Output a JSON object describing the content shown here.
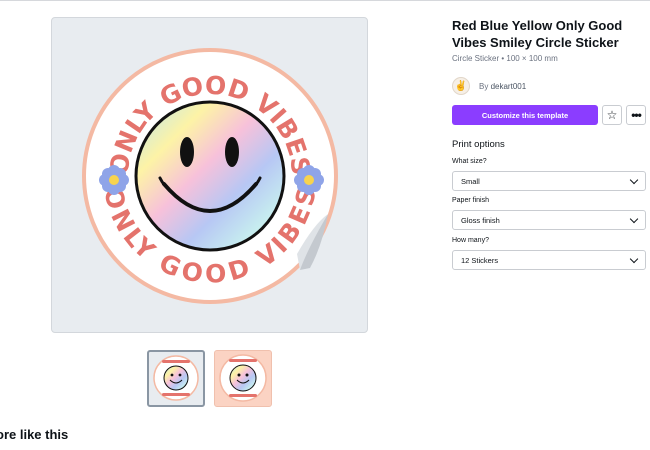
{
  "product": {
    "title": "Red Blue Yellow Only Good Vibes Smiley Circle Sticker",
    "subtitle": "Circle Sticker • 100 × 100 mm",
    "author_prefix": "By",
    "author_name": "dekart001"
  },
  "actions": {
    "customize_label": "Customize this template",
    "favorite_icon": "star-icon",
    "more_icon": "more-options-icon"
  },
  "print_options": {
    "heading": "Print options",
    "size": {
      "label": "What size?",
      "value": "Small"
    },
    "paper": {
      "label": "Paper finish",
      "value": "Gloss finish"
    },
    "quantity": {
      "label": "How many?",
      "value": "12 Stickers"
    }
  },
  "sticker": {
    "text_top": "ONLY GOOD VIBES",
    "text_bottom": "ONLY GOOD VIBES"
  },
  "more_like_this": "ore like this",
  "colors": {
    "accent": "#8b3dff",
    "sticker_text": "#e4736c",
    "sticker_ring": "#f4b9a3",
    "flower": "#8fa4e8"
  }
}
